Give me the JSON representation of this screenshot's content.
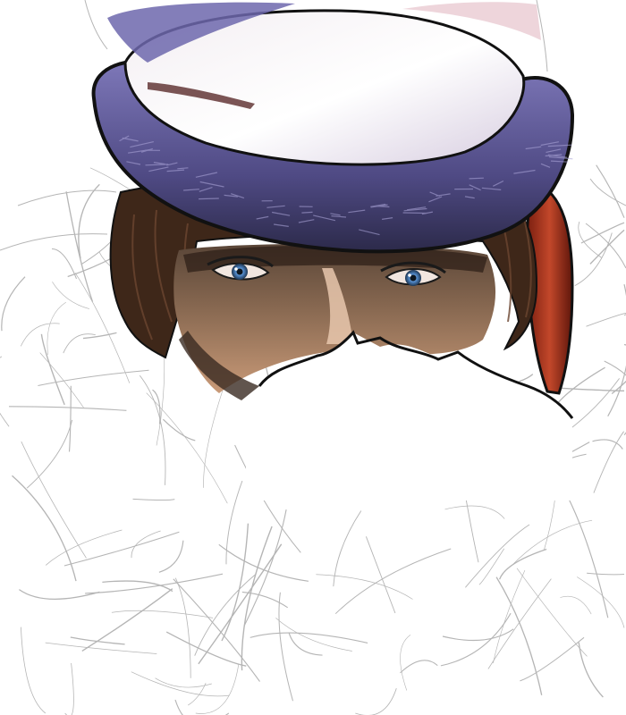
{
  "artwork": {
    "subject": "",
    "palette": {
      "background": "#ffffff",
      "turban_purple": "#6c64a8",
      "turban_light": "#e8e2e6",
      "hair_brown": "#4a2e1e",
      "skin": "#c79a7a",
      "eyes": "#4f86c6",
      "red_cloth": "#b33a22",
      "sketch_line": "#b5b5b5",
      "outline": "#111111"
    }
  }
}
